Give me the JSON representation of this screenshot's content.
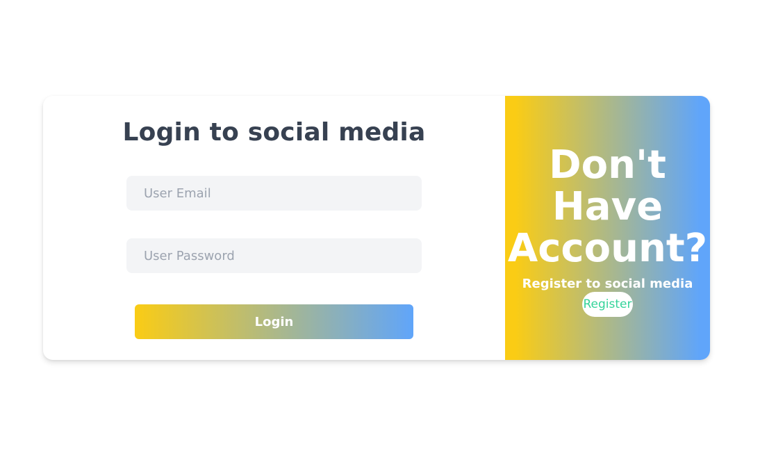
{
  "login": {
    "title": "Login to social media",
    "email_placeholder": "User Email",
    "password_placeholder": "User Password",
    "submit_label": "Login"
  },
  "register": {
    "heading": "Don't Have Account?",
    "subtitle": "Register to social media",
    "button_label": "Register"
  },
  "colors": {
    "gradient_start": "#facc15",
    "gradient_end": "#60a5fa",
    "input_background": "#f3f4f6",
    "title_text": "#374151",
    "register_link": "#34d399"
  }
}
